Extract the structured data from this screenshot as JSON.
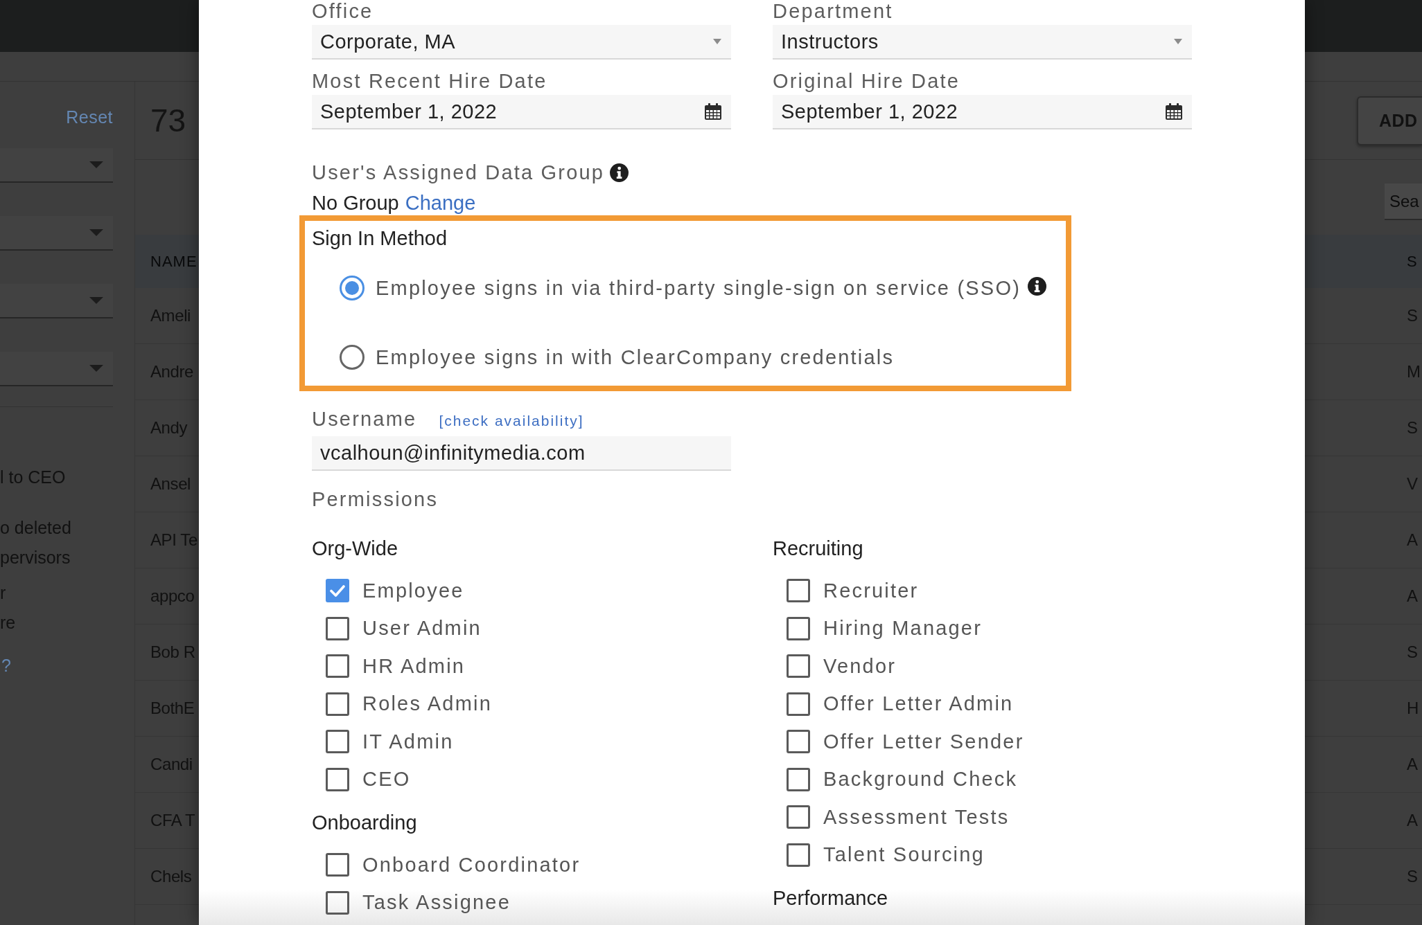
{
  "sidebar": {
    "reset_link": "Reset",
    "filters": [
      {
        "kind": "dropdown"
      },
      {
        "kind": "dropdown"
      },
      {
        "kind": "dropdown"
      },
      {
        "kind": "dropdown"
      }
    ],
    "options": [
      "l to CEO",
      "o deleted\npervisors",
      "r\nre"
    ],
    "help_link": "?"
  },
  "list": {
    "count": "73",
    "add_button": "ADD",
    "search": {
      "placeholder": "Sea"
    },
    "columns": [
      "NAME",
      "S"
    ],
    "rows": [
      [
        "Ameli",
        "S"
      ],
      [
        "Andre",
        "M"
      ],
      [
        "Andy",
        "S"
      ],
      [
        "Ansel",
        "V"
      ],
      [
        "API Te",
        "A"
      ],
      [
        "appco",
        "A"
      ],
      [
        "Bob R",
        "S"
      ],
      [
        "BothE",
        "H"
      ],
      [
        "Candi",
        "A"
      ],
      [
        "CFA T",
        "A"
      ],
      [
        "Chels",
        "S"
      ]
    ]
  },
  "modal": {
    "fields": [
      {
        "label": "Office",
        "value": "Corporate, MA",
        "kind": "select"
      },
      {
        "label": "Department",
        "value": "Instructors",
        "kind": "select"
      },
      {
        "label": "Most Recent Hire Date",
        "value": "September 1, 2022",
        "kind": "date"
      },
      {
        "label": "Original Hire Date",
        "value": "September 1, 2022",
        "kind": "date"
      }
    ],
    "data_group": {
      "label": "User's Assigned Data Group",
      "value": "No Group",
      "link": "Change"
    },
    "sign_in": {
      "title": "Sign In Method",
      "highlighted": true,
      "options": [
        {
          "label": "Employee signs in via third-party single-sign on service (SSO)",
          "selected": true,
          "info": true
        },
        {
          "label": "Employee signs in with ClearCompany credentials",
          "selected": false,
          "info": false
        }
      ]
    },
    "username": {
      "label": "Username",
      "link": "[check availability]",
      "value": "vcalhoun@infinitymedia.com"
    },
    "permissions": {
      "title": "Permissions",
      "columns": [
        {
          "groups": [
            {
              "title": "Org-Wide",
              "items": [
                {
                  "label": "Employee",
                  "checked": true
                },
                {
                  "label": "User Admin",
                  "checked": false
                },
                {
                  "label": "HR Admin",
                  "checked": false
                },
                {
                  "label": "Roles Admin",
                  "checked": false
                },
                {
                  "label": "IT Admin",
                  "checked": false
                },
                {
                  "label": "CEO",
                  "checked": false
                }
              ]
            },
            {
              "title": "Onboarding",
              "items": [
                {
                  "label": "Onboard Coordinator",
                  "checked": false
                },
                {
                  "label": "Task Assignee",
                  "checked": false
                }
              ]
            }
          ]
        },
        {
          "groups": [
            {
              "title": "Recruiting",
              "items": [
                {
                  "label": "Recruiter",
                  "checked": false
                },
                {
                  "label": "Hiring Manager",
                  "checked": false
                },
                {
                  "label": "Vendor",
                  "checked": false
                },
                {
                  "label": "Offer Letter Admin",
                  "checked": false
                },
                {
                  "label": "Offer Letter Sender",
                  "checked": false
                },
                {
                  "label": "Background Check",
                  "checked": false
                },
                {
                  "label": "Assessment Tests",
                  "checked": false
                },
                {
                  "label": "Talent Sourcing",
                  "checked": false
                }
              ]
            },
            {
              "title": "Performance"
            }
          ]
        }
      ]
    }
  }
}
